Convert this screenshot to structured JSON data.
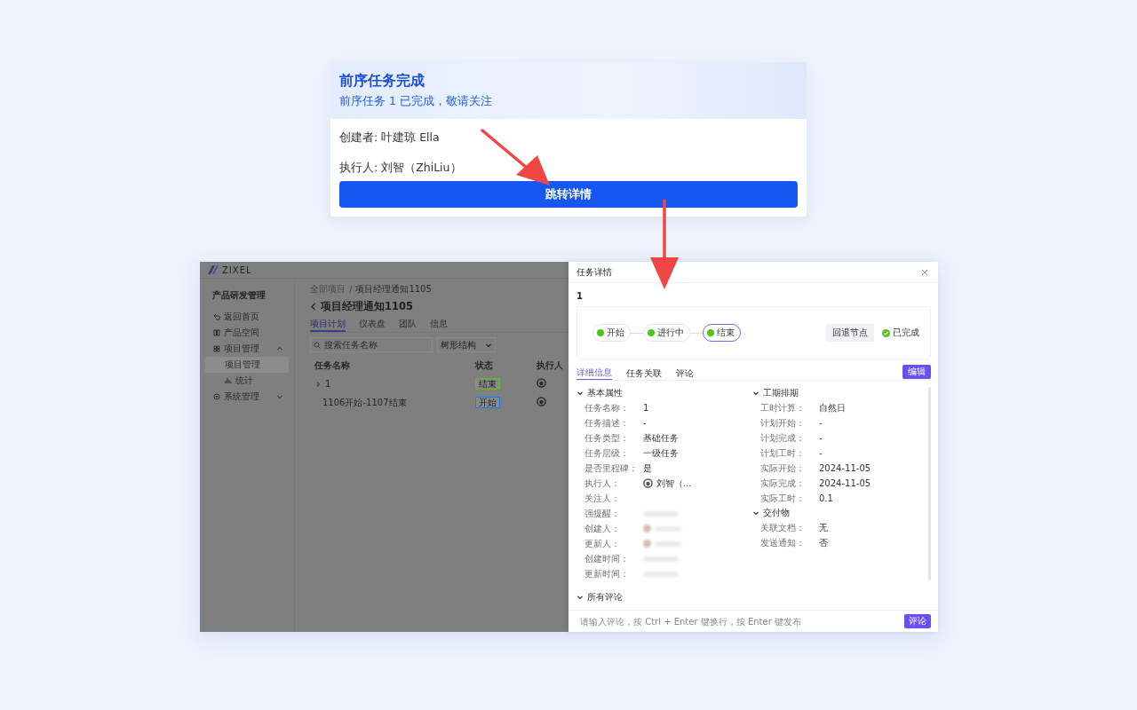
{
  "notification_card": {
    "title": "前序任务完成",
    "subtitle": "前序任务 1 已完成，敬请关注",
    "lines": [
      "创建者: 叶建琼 Ella",
      "执行人: 刘智（ZhiLiu）"
    ],
    "button": "跳转详情"
  },
  "background_app": {
    "logo": "ZIXEL",
    "sidebar": {
      "title": "产品研发管理",
      "items": [
        {
          "label": "返回首页",
          "kind": "link",
          "selected": false
        },
        {
          "label": "产品空间",
          "kind": "link",
          "selected": false
        },
        {
          "label": "项目管理",
          "kind": "group",
          "expanded": true,
          "selected": false,
          "children": [
            {
              "label": "项目管理",
              "selected": true
            },
            {
              "label": "统计",
              "selected": false
            }
          ]
        },
        {
          "label": "系统管理",
          "kind": "group",
          "expanded": false,
          "selected": false
        }
      ]
    },
    "breadcrumb": [
      "全部项目",
      "项目经理通知1105"
    ],
    "breadcrumb_separator": "/",
    "title": "项目经理通知1105",
    "tabs": [
      {
        "label": "项目计划",
        "selected": true
      },
      {
        "label": "仪表盘",
        "selected": false
      },
      {
        "label": "团队",
        "selected": false
      },
      {
        "label": "信息",
        "selected": false
      }
    ],
    "search": {
      "placeholder": "搜索任务名称"
    },
    "view_select": "树形结构",
    "table": {
      "columns": [
        "任务名称",
        "状态",
        "执行人"
      ],
      "rows": [
        {
          "name": "1",
          "kind": "group",
          "expanded": false,
          "status": {
            "label": "结束",
            "color": "#52c41a"
          }
        },
        {
          "name": "1106开始-1107结束",
          "kind": "task",
          "status": {
            "label": "开始",
            "color": "#1677ff"
          }
        }
      ]
    }
  },
  "detail_panel": {
    "title": "任务详情",
    "task_name": "1",
    "flow": {
      "nodes": [
        {
          "label": "开始",
          "selected": false
        },
        {
          "label": "进行中",
          "selected": false
        },
        {
          "label": "结束",
          "selected": true
        }
      ],
      "rollback_button": "回退节点",
      "status": "已完成"
    },
    "tabs": [
      {
        "label": "详细信息",
        "selected": true
      },
      {
        "label": "任务关联",
        "selected": false
      },
      {
        "label": "评论",
        "selected": false
      }
    ],
    "edit_button": "编辑",
    "columns": [
      [
        {
          "title": "基本属性",
          "fields": [
            {
              "label": "任务名称：",
              "kind": "text",
              "value": "1"
            },
            {
              "label": "任务描述：",
              "kind": "text",
              "value": "-"
            },
            {
              "label": "任务类型：",
              "kind": "text",
              "value": "基础任务"
            },
            {
              "label": "任务层级：",
              "kind": "text",
              "value": "一级任务"
            },
            {
              "label": "是否里程碑：",
              "kind": "text",
              "value": "是"
            },
            {
              "label": "执行人：",
              "kind": "avatar",
              "value": "刘智（..."
            },
            {
              "label": "关注人：",
              "kind": "empty"
            },
            {
              "label": "强提醒：",
              "kind": "blurred"
            },
            {
              "label": "创建人：",
              "kind": "blurred_avatar"
            },
            {
              "label": "更新人：",
              "kind": "blurred_avatar"
            },
            {
              "label": "创建时间：",
              "kind": "blurred"
            },
            {
              "label": "更新时间：",
              "kind": "blurred"
            }
          ]
        }
      ],
      [
        {
          "title": "工期排期",
          "fields": [
            {
              "label": "工时计算：",
              "kind": "text",
              "value": "自然日"
            },
            {
              "label": "计划开始：",
              "kind": "text",
              "value": "-"
            },
            {
              "label": "计划完成：",
              "kind": "text",
              "value": "-"
            },
            {
              "label": "计划工时：",
              "kind": "text",
              "value": "-"
            },
            {
              "label": "实际开始：",
              "kind": "text",
              "value": "2024-11-05"
            },
            {
              "label": "实际完成：",
              "kind": "text",
              "value": "2024-11-05"
            },
            {
              "label": "实际工时：",
              "kind": "text",
              "value": "0.1"
            }
          ]
        },
        {
          "title": "交付物",
          "fields": [
            {
              "label": "关联文档：",
              "kind": "text",
              "value": "无"
            },
            {
              "label": "发送通知：",
              "kind": "text",
              "value": "否"
            }
          ]
        }
      ]
    ],
    "comments_section": "所有评论",
    "comment_box": {
      "placeholder": "请输入评论，按 Ctrl + Enter 键换行，按 Enter 键发布",
      "button": "评论"
    }
  }
}
